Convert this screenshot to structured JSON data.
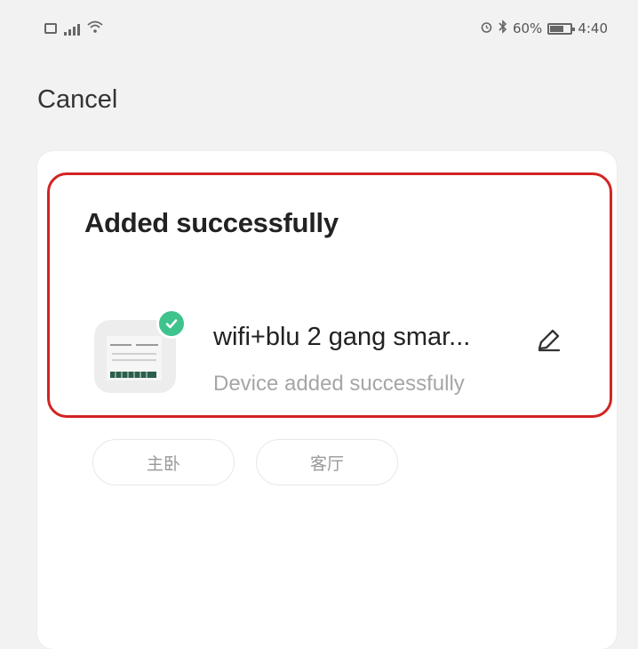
{
  "status_bar": {
    "battery": "60%",
    "time": "4:40",
    "icons_left": [
      "sim-icon",
      "signal-icon",
      "wifi-icon"
    ],
    "icons_right": [
      "alarm-icon",
      "bluetooth-icon",
      "battery-icon"
    ]
  },
  "header": {
    "cancel_label": "Cancel"
  },
  "result_card": {
    "title": "Added successfully",
    "device": {
      "name": "wifi+blu 2 gang smar...",
      "status": "Device added successfully",
      "image_icon": "device-image-icon",
      "badge_icon": "check-circle-icon",
      "edit_icon": "pencil-icon"
    },
    "rooms": [
      {
        "label": "主卧"
      },
      {
        "label": "客厅"
      }
    ]
  },
  "colors": {
    "highlight_border": "#d32323",
    "success_green": "#3ec38c",
    "secondary_text": "#a6a6a6",
    "background": "#f2f2f2",
    "card_background": "#ffffff"
  }
}
